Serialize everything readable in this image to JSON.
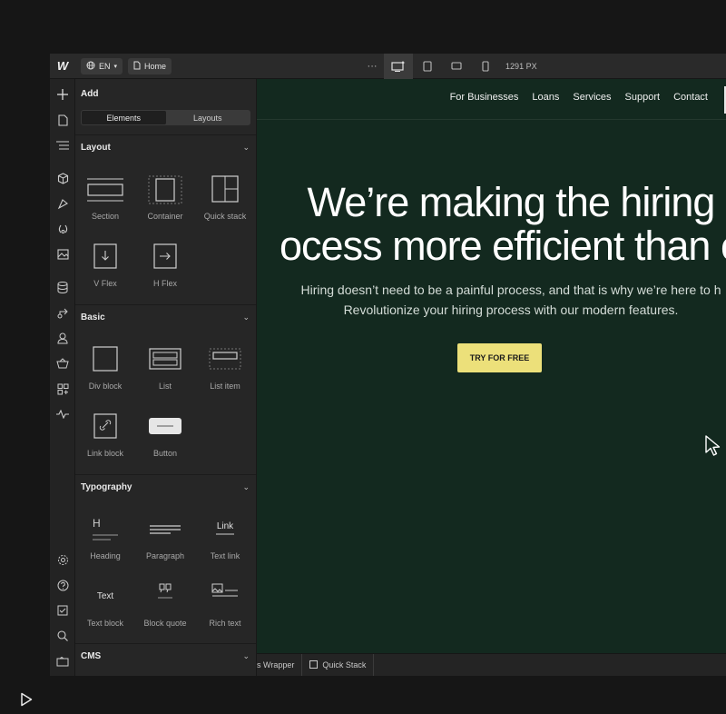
{
  "topbar": {
    "logo": "W",
    "lang_label": "EN",
    "page_label": "Home",
    "more": "···",
    "canvas_width": "1291 PX"
  },
  "panel": {
    "title": "Add",
    "tabs": [
      "Elements",
      "Layouts"
    ],
    "sections": {
      "layout": {
        "title": "Layout",
        "items": [
          "Section",
          "Container",
          "Quick stack",
          "V Flex",
          "H Flex"
        ]
      },
      "basic": {
        "title": "Basic",
        "items": [
          "Div block",
          "List",
          "List item",
          "Link block",
          "Button"
        ]
      },
      "typography": {
        "title": "Typography",
        "items": [
          "Heading",
          "Paragraph",
          "Text link",
          "Text block",
          "Block quote",
          "Rich text"
        ],
        "icon_text": {
          "heading": "H",
          "text_link": "Link",
          "text_block": "Text"
        }
      },
      "cms": {
        "title": "CMS"
      }
    }
  },
  "site": {
    "nav": [
      "For Businesses",
      "Loans",
      "Services",
      "Support",
      "Contact"
    ],
    "hero_line1": "We’re making the hiring",
    "hero_line2": "ocess more efficient than e",
    "sub_line1": "Hiring doesn’t need to be a painful process, and that is why we’re here to h",
    "sub_line2": "Revolutionize your hiring process with our modern features.",
    "cta": "TRY FOR FREE"
  },
  "breadcrumbs": [
    "s Wrapper",
    "Quick Stack"
  ],
  "colors": {
    "canvas_bg": "#13291f",
    "cta_bg": "#ece07a",
    "panel_bg": "#262626"
  }
}
